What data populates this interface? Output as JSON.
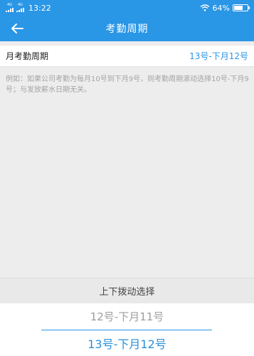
{
  "status_bar": {
    "signal_a": "4G",
    "signal_b": "4G",
    "time": "13:22",
    "battery": "64%"
  },
  "header": {
    "title": "考勤周期"
  },
  "setting": {
    "label": "月考勤周期",
    "value": "13号-下月12号"
  },
  "hint": "例如：如果公司考勤为每月10号到下月9号，则考勤周期滚动选择10号-下月9号；与发放薪水日期无关。",
  "picker": {
    "title": "上下拨动选择",
    "option_above": "12号-下月11号",
    "option_selected": "13号-下月12号"
  },
  "colors": {
    "accent": "#2a96e6",
    "page_bg": "#ededed",
    "selected_text": "#2a8fd8"
  }
}
